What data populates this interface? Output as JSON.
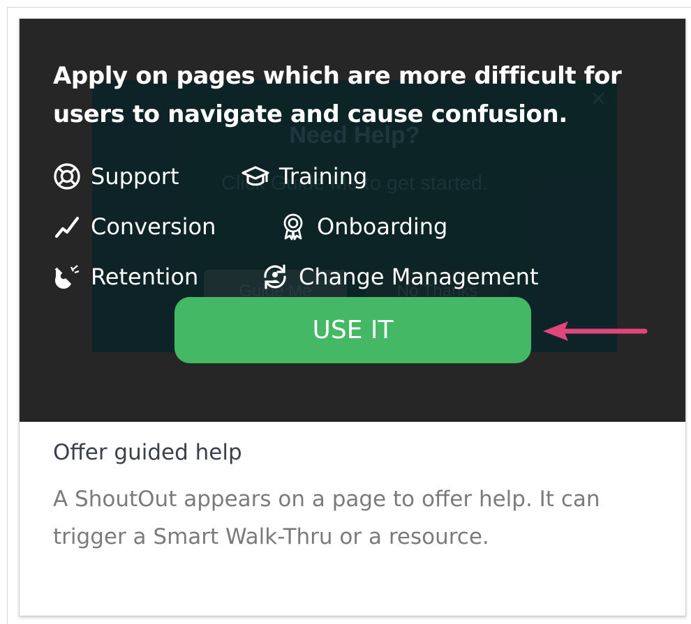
{
  "headline": "Apply on pages which are more difficult for users to navigate and cause confusion.",
  "ghost": {
    "title": "Need Help?",
    "subtitle": "Click Guide Me to get started.",
    "primary_button": "Guide Me",
    "secondary_button": "No Thanks"
  },
  "use_cases": [
    {
      "label": "Support",
      "icon": "lifebuoy-icon"
    },
    {
      "label": "Training",
      "icon": "graduation-cap-icon"
    },
    {
      "label": "Conversion",
      "icon": "trend-line-icon"
    },
    {
      "label": "Onboarding",
      "icon": "award-badge-icon"
    },
    {
      "label": "Retention",
      "icon": "magnet-icon"
    },
    {
      "label": "Change Management",
      "icon": "person-cycle-icon"
    }
  ],
  "use_button": "USE IT",
  "card": {
    "title": "Offer guided help",
    "description": "A ShoutOut appears on a page to offer help. It can trigger a Smart Walk-Thru or a resource."
  },
  "colors": {
    "preview_bg": "#262626",
    "button_green": "#44b865",
    "arrow_pink": "#e0457b",
    "title_text": "#3a3f4a",
    "desc_text": "#7b7b7b"
  }
}
